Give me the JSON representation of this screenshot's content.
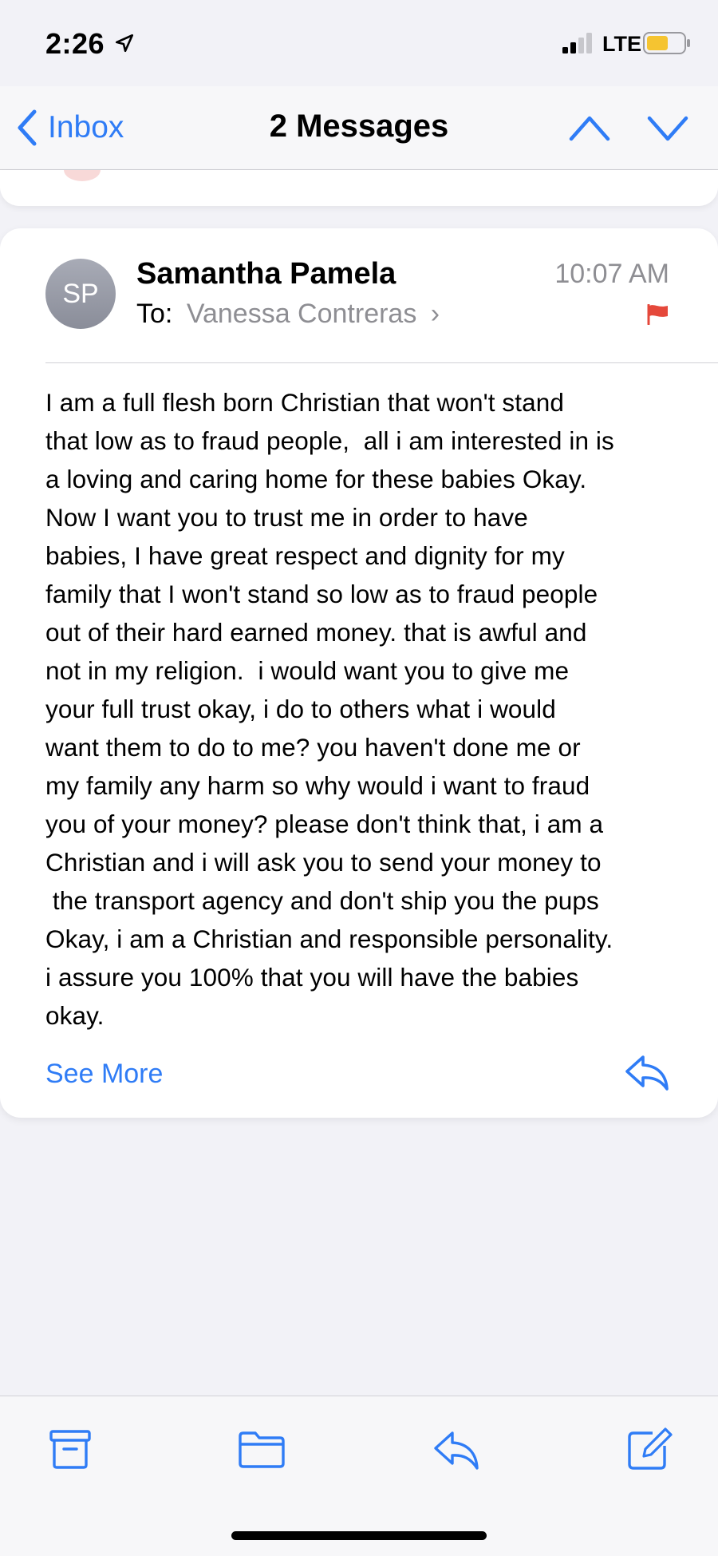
{
  "status_bar": {
    "time": "2:26",
    "network": "LTE",
    "icons": [
      "location-arrow-icon",
      "cellular-signal-icon",
      "battery-icon"
    ]
  },
  "nav": {
    "back_label": "Inbox",
    "title": "2 Messages",
    "icons": [
      "chevron-left-icon",
      "chevron-up-icon",
      "chevron-down-icon"
    ]
  },
  "message": {
    "avatar_initials": "SP",
    "sender": "Samantha Pamela",
    "to_label": "To:",
    "recipient": "Vanessa Contreras",
    "time": "10:07 AM",
    "flagged": true,
    "body_lines": [
      "I am a full flesh born Christian that won't stand",
      "that low as to fraud people,  all i am interested in is",
      "a loving and caring home for these babies Okay.",
      "Now I want you to trust me in order to have",
      "babies, I have great respect and dignity for my",
      "family that I won't stand so low as to fraud people",
      "out of their hard earned money. that is awful and",
      "not in my religion.  i would want you to give me",
      "your full trust okay, i do to others what i would",
      "want them to do to me? you haven't done me or",
      "my family any harm so why would i want to fraud",
      "you of your money? please don't think that, i am a",
      "Christian and i will ask you to send your money to",
      " the transport agency and don't ship you the pups",
      "Okay, i am a Christian and responsible personality.",
      "i assure you 100% that you will have the babies",
      "okay."
    ],
    "see_more_label": "See More"
  },
  "toolbar": {
    "icons": [
      "archive-icon",
      "folder-icon",
      "reply-icon",
      "compose-icon"
    ]
  },
  "colors": {
    "accent": "#2f7cf6",
    "flag": "#e5483b",
    "secondary_text": "#8e8e93",
    "background": "#f2f2f7"
  }
}
